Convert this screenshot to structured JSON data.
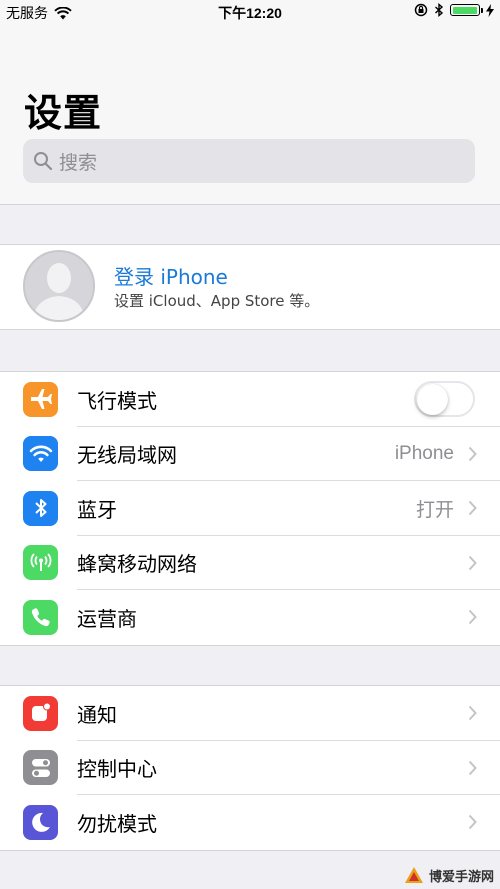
{
  "status_bar": {
    "carrier": "无服务",
    "time": "下午12:20",
    "battery_level": 1.0
  },
  "header": {
    "title": "设置",
    "search_placeholder": "搜索"
  },
  "account": {
    "title": "登录 iPhone",
    "subtitle": "设置 iCloud、App Store 等。"
  },
  "group1": [
    {
      "label": "飞行模式",
      "icon": "airplane-icon",
      "color": "#f7952b",
      "type": "toggle",
      "on": false
    },
    {
      "label": "无线局域网",
      "icon": "wifi-icon",
      "color": "#1e82f0",
      "value": "iPhone"
    },
    {
      "label": "蓝牙",
      "icon": "bluetooth-icon",
      "color": "#1e82f0",
      "value": "打开"
    },
    {
      "label": "蜂窝移动网络",
      "icon": "cellular-icon",
      "color": "#4cd964",
      "value": ""
    },
    {
      "label": "运营商",
      "icon": "phone-icon",
      "color": "#4cd964",
      "value": ""
    }
  ],
  "group2": [
    {
      "label": "通知",
      "icon": "notifications-icon",
      "color": "#f23b35"
    },
    {
      "label": "控制中心",
      "icon": "control-center-icon",
      "color": "#8e8e93"
    },
    {
      "label": "勿扰模式",
      "icon": "moon-icon",
      "color": "#5856d6"
    }
  ],
  "watermark": "博爱手游网"
}
